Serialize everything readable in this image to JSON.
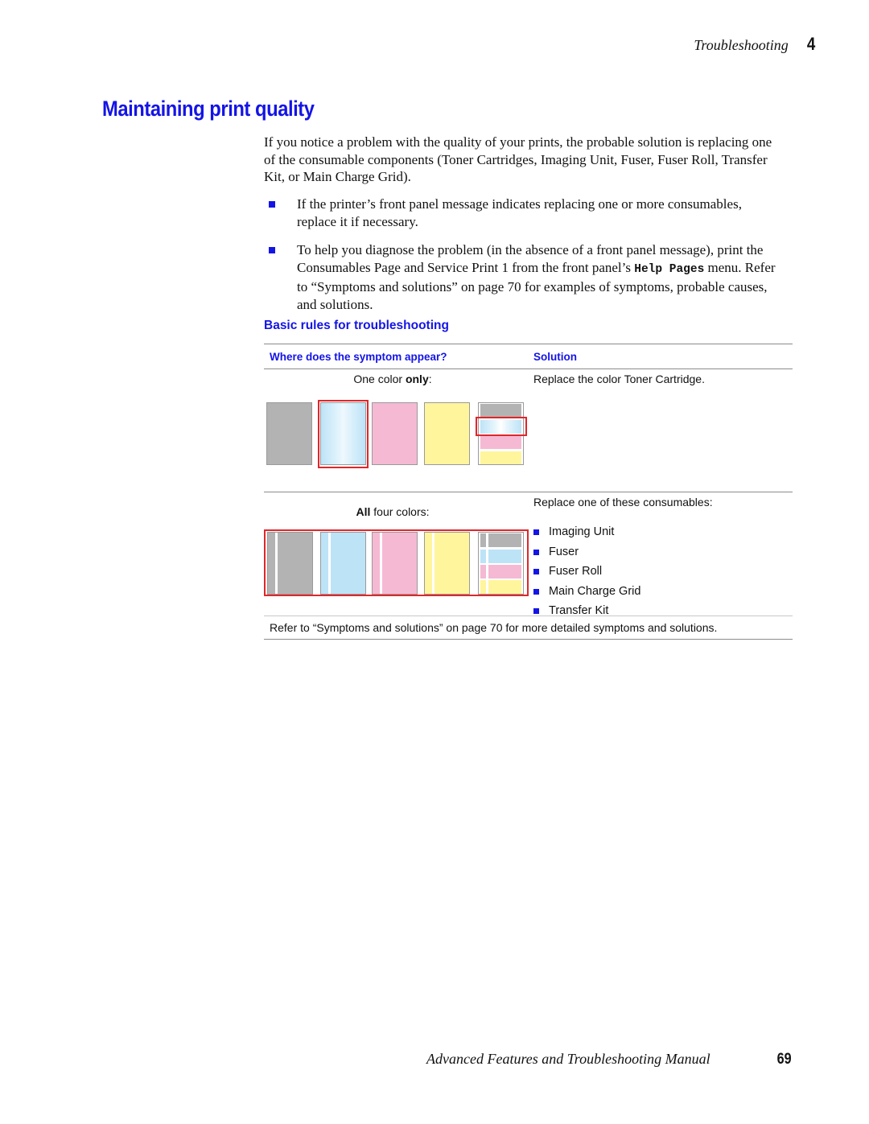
{
  "running_head": {
    "section": "Troubleshooting",
    "chapter": "4"
  },
  "title": "Maintaining print quality",
  "intro": "If you notice a problem with the quality of your prints, the probable solution is replacing one of the consumable components (Toner Cartridges, Imaging Unit, Fuser, Fuser Roll, Transfer Kit, or Main Charge Grid).",
  "bullets": [
    {
      "text": "If the printer’s front panel message indicates replacing one or more consumables, replace it if necessary."
    },
    {
      "text_before": "To help you diagnose the problem (in the absence of a front panel message), print the Consumables Page and Service Print 1 from the front panel’s ",
      "code": "Help Pages",
      "text_after": " menu.  Refer to “Symptoms and solutions” on page 70 for examples of symptoms, probable causes, and solutions."
    }
  ],
  "subheading": "Basic rules for troubleshooting",
  "table": {
    "headers": [
      "Where does the symptom appear?",
      "Solution"
    ],
    "rows": [
      {
        "symptom_prefix": "One color ",
        "symptom_bold": "only",
        "symptom_suffix": ":",
        "solution": "Replace the color Toner Cartridge.",
        "samples": [
          "black",
          "cyan (faded, highlighted)",
          "magenta",
          "yellow",
          "composite (cyan band highlighted)"
        ]
      },
      {
        "symptom_bold": "All",
        "symptom_suffix": " four colors:",
        "solution": "Replace one of these consumables:",
        "consumables": [
          "Imaging Unit",
          "Fuser",
          "Fuser Roll",
          "Main Charge Grid",
          "Transfer Kit"
        ],
        "samples": [
          "black",
          "cyan",
          "magenta",
          "yellow",
          "composite"
        ]
      }
    ],
    "note": "Refer to “Symptoms and solutions” on page 70 for more detailed symptoms and solutions."
  },
  "footer": {
    "manual": "Advanced Features and Troubleshooting Manual",
    "page": "69"
  },
  "colors": {
    "accent_blue": "#1414e6",
    "highlight_red": "#e0262a",
    "black_toner": "#b3b3b3",
    "cyan_toner": "#bde3f7",
    "magenta_toner": "#f5b9d3",
    "yellow_toner": "#fff59c"
  }
}
